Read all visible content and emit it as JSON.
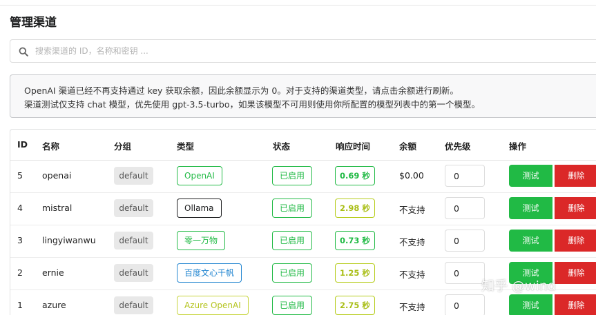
{
  "page": {
    "title": "管理渠道"
  },
  "search": {
    "placeholder": "搜索渠道的 ID，名称和密钥 ..."
  },
  "notice": {
    "line1": "OpenAI 渠道已经不再支持通过 key 获取余额，因此余额显示为 0。对于支持的渠道类型，请点击余额进行刷新。",
    "line2": "渠道测试仅支持 chat 模型，优先使用 gpt-3.5-turbo，如果该模型不可用则使用你所配置的模型列表中的第一个模型。"
  },
  "table": {
    "headers": {
      "id": "ID",
      "name": "名称",
      "group": "分组",
      "type": "类型",
      "status": "状态",
      "response_time": "响应时间",
      "balance": "余额",
      "priority": "优先级",
      "actions": "操作"
    },
    "rows": [
      {
        "id": "5",
        "name": "openai",
        "group": "default",
        "type": "OpenAI",
        "status": "已启用",
        "response_time": "0.69 秒",
        "balance": "$0.00",
        "priority": "0",
        "test_label": "测试",
        "delete_label": "删除"
      },
      {
        "id": "4",
        "name": "mistral",
        "group": "default",
        "type": "Ollama",
        "status": "已启用",
        "response_time": "2.98 秒",
        "balance": "不支持",
        "priority": "0",
        "test_label": "测试",
        "delete_label": "删除"
      },
      {
        "id": "3",
        "name": "lingyiwanwu",
        "group": "default",
        "type": "零一万物",
        "status": "已启用",
        "response_time": "0.73 秒",
        "balance": "不支持",
        "priority": "0",
        "test_label": "测试",
        "delete_label": "删除"
      },
      {
        "id": "2",
        "name": "ernie",
        "group": "default",
        "type": "百度文心千帆",
        "status": "已启用",
        "response_time": "1.25 秒",
        "balance": "不支持",
        "priority": "0",
        "test_label": "测试",
        "delete_label": "删除"
      },
      {
        "id": "1",
        "name": "azure",
        "group": "default",
        "type": "Azure OpenAI",
        "status": "已启用",
        "response_time": "2.75 秒",
        "balance": "不支持",
        "priority": "0",
        "test_label": "测试",
        "delete_label": "删除"
      }
    ]
  },
  "watermark": {
    "text": "知乎 @wind"
  },
  "colors": {
    "success": "#21ba45",
    "danger": "#db2828",
    "info": "#2185d0",
    "olive": "#b5cc18"
  }
}
